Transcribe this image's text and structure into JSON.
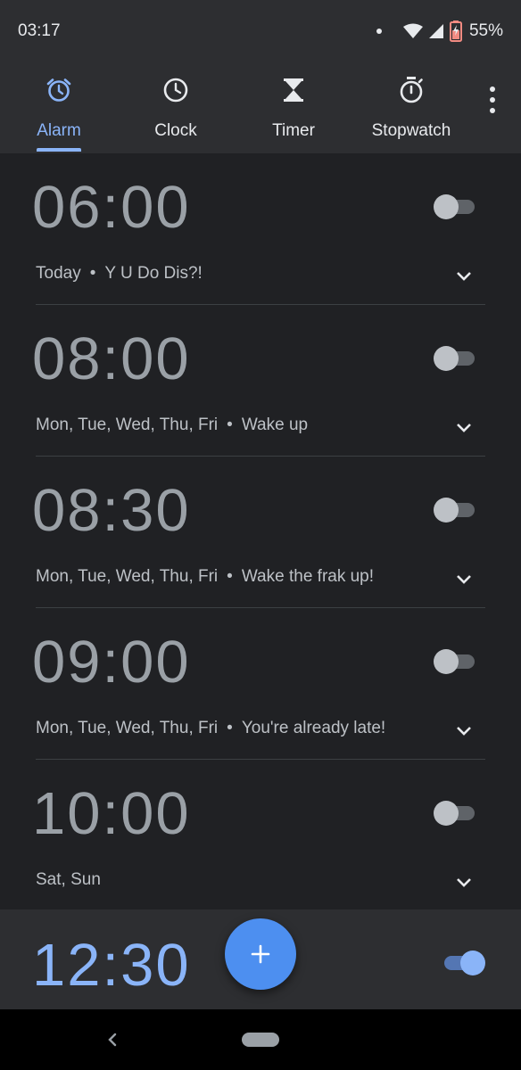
{
  "status_bar": {
    "time": "03:17",
    "battery": "55%",
    "icons": [
      "notification-dot-icon",
      "wifi-icon",
      "cell-signal-icon",
      "battery-icon"
    ]
  },
  "tabs": [
    {
      "label": "Alarm",
      "icon": "alarm-icon",
      "active": true
    },
    {
      "label": "Clock",
      "icon": "clock-icon",
      "active": false
    },
    {
      "label": "Timer",
      "icon": "hourglass-icon",
      "active": false
    },
    {
      "label": "Stopwatch",
      "icon": "stopwatch-icon",
      "active": false
    }
  ],
  "alarms": [
    {
      "time": "06:00",
      "days": "Today",
      "label": "Y U Do Dis?!",
      "enabled": false
    },
    {
      "time": "08:00",
      "days": "Mon, Tue, Wed, Thu, Fri",
      "label": "Wake up",
      "enabled": false
    },
    {
      "time": "08:30",
      "days": "Mon, Tue, Wed, Thu, Fri",
      "label": "Wake the frak up!",
      "enabled": false
    },
    {
      "time": "09:00",
      "days": "Mon, Tue, Wed, Thu, Fri",
      "label": "You're already late!",
      "enabled": false
    },
    {
      "time": "10:00",
      "days": "Sat, Sun",
      "label": "",
      "enabled": false
    }
  ],
  "active_alarm": {
    "time": "12:30",
    "enabled": true
  },
  "separator": "•",
  "colors": {
    "background": "#202124",
    "surface": "#2d2e31",
    "accent": "#8ab4f8",
    "fab": "#4d8ff0",
    "time_inactive": "#9aa0a6"
  }
}
